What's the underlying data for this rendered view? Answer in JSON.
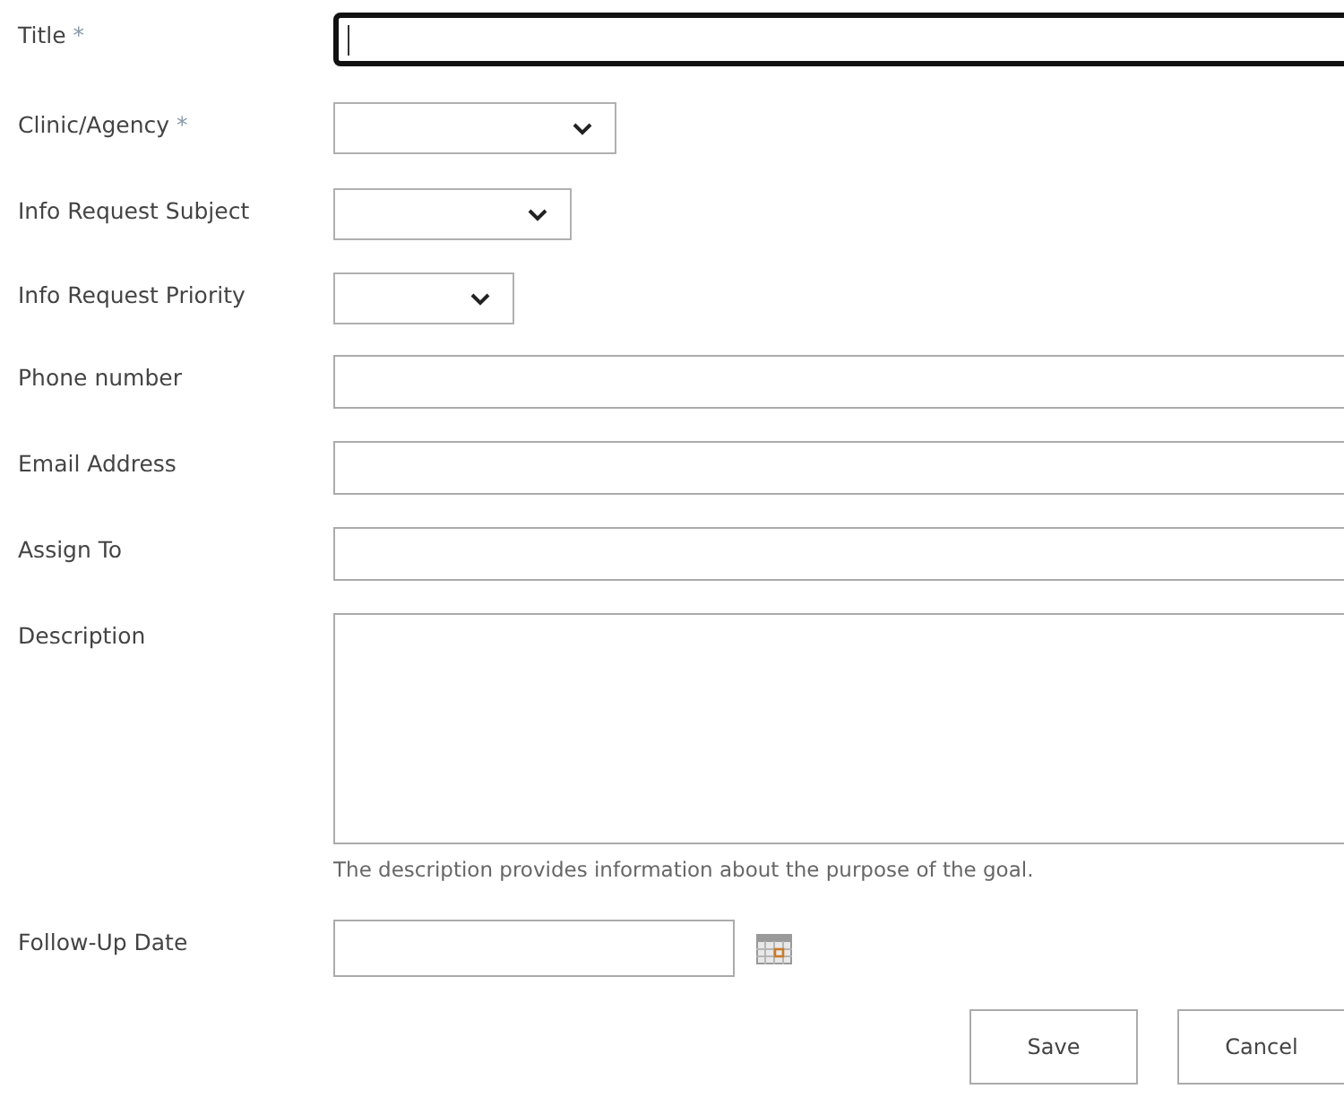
{
  "fields": [
    {
      "label": "Title",
      "required_mark": "*",
      "kind": "text",
      "focused": true
    },
    {
      "label": "Clinic/Agency",
      "required_mark": "*",
      "kind": "select",
      "focused": false
    },
    {
      "label": "Info Request Subject",
      "kind": "select",
      "focused": false
    },
    {
      "label": "Info Request Priority",
      "kind": "select",
      "focused": false
    },
    {
      "label": "Phone number",
      "kind": "text",
      "focused": false
    },
    {
      "label": "Email Address",
      "kind": "text",
      "focused": false
    },
    {
      "label": "Assign To",
      "kind": "text",
      "focused": false
    },
    {
      "label": "Description",
      "kind": "textarea",
      "hint": "The description provides information about the purpose of the goal.",
      "focused": false
    },
    {
      "label": "Follow-Up Date",
      "kind": "date",
      "focused": false
    }
  ],
  "buttons": [
    "Save",
    "Cancel"
  ]
}
